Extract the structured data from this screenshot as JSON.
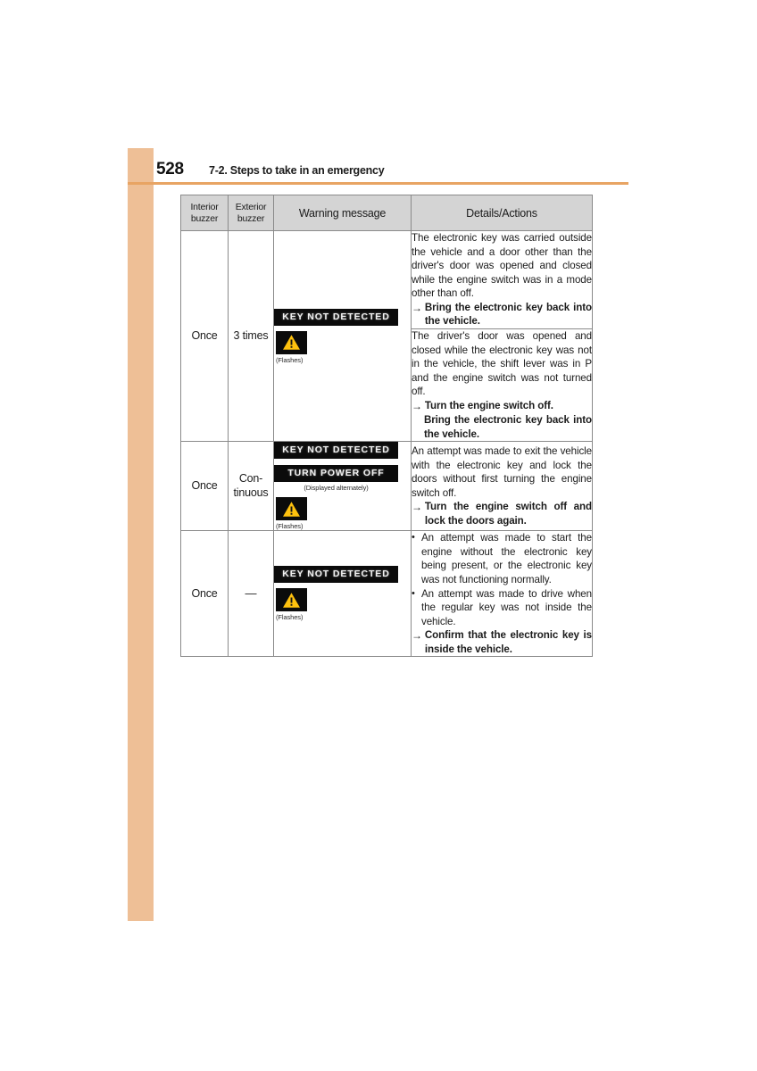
{
  "page": {
    "number": "528",
    "chapter_title": "7-2. Steps to take in an emergency",
    "accent_color": "#eebf96",
    "rule_color": "#e8a463"
  },
  "table": {
    "headers": {
      "interior_line1": "Interior",
      "interior_line2": "buzzer",
      "exterior_line1": "Exterior",
      "exterior_line2": "buzzer",
      "warning_message": "Warning message",
      "details_actions": "Details/Actions"
    },
    "rows": [
      {
        "interior_buzzer": "Once",
        "exterior_buzzer": "3 times",
        "warning": {
          "lcd_messages": [
            "KEY NOT DETECTED"
          ],
          "alternately_note": "",
          "flashes_note": "(Flashes)",
          "icon": "warning-triangle-icon"
        },
        "details": [
          {
            "paragraph": "The electronic key was carried outside the vehicle and a door other than the driver's door was opened and closed while the engine switch was in a mode other than off.",
            "arrow": "→",
            "actions": [
              "Bring the electronic key back into the vehicle."
            ]
          },
          {
            "paragraph": "The driver's door was opened and closed while the electronic key was not in the vehicle, the shift lever was in P and the engine switch was not turned off.",
            "arrow": "→",
            "actions": [
              "Turn the engine switch off.",
              "Bring the electronic key back into the vehicle."
            ]
          }
        ]
      },
      {
        "interior_buzzer": "Once",
        "exterior_buzzer_line1": "Con-",
        "exterior_buzzer_line2": "tinuous",
        "warning": {
          "lcd_messages": [
            "KEY NOT DETECTED",
            "TURN POWER OFF"
          ],
          "alternately_note": "(Displayed alternately)",
          "flashes_note": "(Flashes)",
          "icon": "warning-triangle-icon"
        },
        "details": [
          {
            "paragraph": "An attempt was made to exit the vehicle with the electronic key and lock the doors without first turning the engine switch off.",
            "arrow": "→",
            "actions": [
              "Turn the engine switch off and lock the doors again."
            ]
          }
        ]
      },
      {
        "interior_buzzer": "Once",
        "exterior_buzzer": "—",
        "warning": {
          "lcd_messages": [
            "KEY NOT DETECTED"
          ],
          "alternately_note": "",
          "flashes_note": "(Flashes)",
          "icon": "warning-triangle-icon"
        },
        "details_bullets": [
          "An attempt was made to start the engine without the electronic key being present, or the electronic key was not functioning normally.",
          "An attempt was made to drive when the regular key was not inside the vehicle."
        ],
        "details_action": {
          "arrow": "→",
          "text": "Confirm that the electronic key is inside the vehicle."
        },
        "bullet_char": "•"
      }
    ]
  },
  "colors": {
    "lcd_background": "#0b0b0b",
    "lcd_text": "#f2f2f2",
    "warning_yellow": "#ffc20e",
    "header_background": "#d4d4d4",
    "border": "#8a8a8a"
  }
}
